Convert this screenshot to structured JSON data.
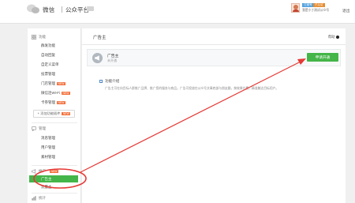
{
  "header": {
    "brand": "微信",
    "platform": "公众平台",
    "account_name": "我是小丁测试公众号",
    "logout": "退出",
    "tags": [
      "订阅号",
      "已认证"
    ]
  },
  "sidebar": {
    "sections": [
      {
        "title": "功能",
        "icon": "grid-icon",
        "items": [
          {
            "label": "群发功能"
          },
          {
            "label": "自动回复"
          },
          {
            "label": "自定义菜单"
          },
          {
            "label": "投票管理"
          },
          {
            "label": "门店管理",
            "badge": "NEW"
          },
          {
            "label": "微信连Wi-Fi",
            "badge": "NEW"
          },
          {
            "label": "卡券管理",
            "badge": "NEW"
          }
        ]
      },
      {
        "title": "管理",
        "icon": "chat-icon",
        "items": [
          {
            "label": "消息管理"
          },
          {
            "label": "用户管理"
          },
          {
            "label": "素材管理"
          }
        ]
      },
      {
        "title": "推广",
        "icon": "megaphone-icon",
        "badge": "NEW",
        "items": [
          {
            "label": "广告主"
          },
          {
            "label": "流量主"
          }
        ]
      },
      {
        "title": "统计",
        "icon": "chart-icon",
        "items": []
      }
    ],
    "add_plugin": "+ 添加功能插件",
    "add_plugin_badge": "NEW",
    "active_item": "广告主"
  },
  "main": {
    "title": "广告主",
    "help": "帮助",
    "feature": {
      "name": "广告主",
      "status": "未开通"
    },
    "apply_button": "申请开通",
    "intro_title": "功能介绍",
    "intro_text": "广告主可在向目标人群推广品牌、推广您的服务与商品。广告可投放在公众号文章底部与朋友圈，按效果付费，精准触达目标用户。"
  },
  "colors": {
    "accent": "#44b549",
    "annotation": "#e53935",
    "new_badge": "#f36e39"
  }
}
